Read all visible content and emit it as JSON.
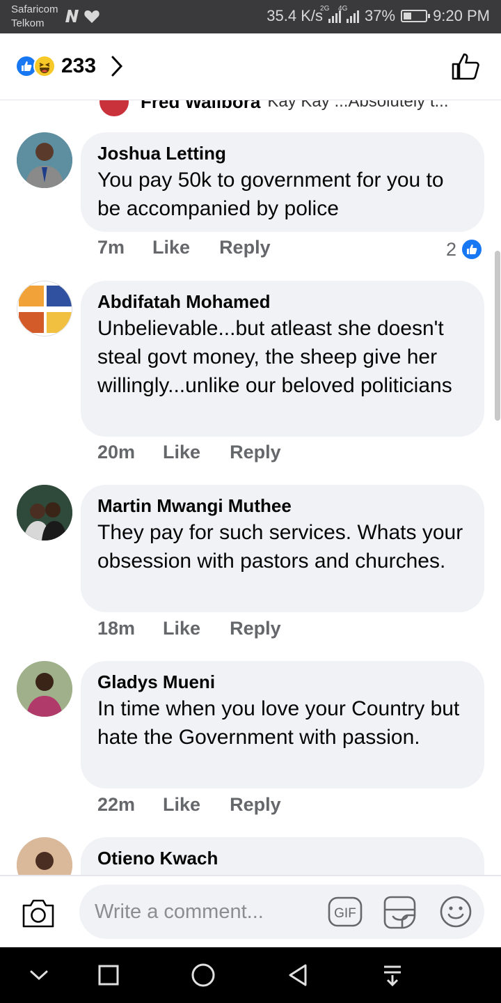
{
  "status_bar": {
    "carrier_1": "Safaricom",
    "carrier_2": "Telkom",
    "speed": "35.4 K/s",
    "net_1": "2G",
    "net_2": "4G",
    "battery": "37%",
    "battery_level": 0.37,
    "time": "9:20 PM"
  },
  "header": {
    "reaction_count": "233",
    "reaction_icons": [
      "like-icon",
      "haha-icon"
    ]
  },
  "peek_comment": {
    "name": "Fred Walibora",
    "text": "Kay Kay ...Absolutely t..."
  },
  "comments": [
    {
      "name": "Joshua Letting",
      "text": "You pay 50k to government for you to be accompanied by police",
      "time": "7m",
      "like_label": "Like",
      "reply_label": "Reply",
      "likes": "2"
    },
    {
      "name": "Abdifatah Mohamed",
      "text": "Unbelievable...but atleast she doesn't steal govt money, the sheep give her willingly...unlike our beloved politicians",
      "time": "20m",
      "like_label": "Like",
      "reply_label": "Reply"
    },
    {
      "name": "Martin Mwangi Muthee",
      "text": "They pay for such services. Whats your obsession with pastors and churches.",
      "time": "18m",
      "like_label": "Like",
      "reply_label": "Reply"
    },
    {
      "name": "Gladys Mueni",
      "text": "In time when you love your Country but hate the Government with passion.",
      "time": "22m",
      "like_label": "Like",
      "reply_label": "Reply"
    },
    {
      "name": "Otieno Kwach"
    }
  ],
  "composer": {
    "placeholder": "Write a comment...",
    "gif_label": "GIF"
  },
  "colors": {
    "brand_blue": "#1877f2",
    "bubble": "#f0f2f5",
    "muted": "#65676b"
  }
}
